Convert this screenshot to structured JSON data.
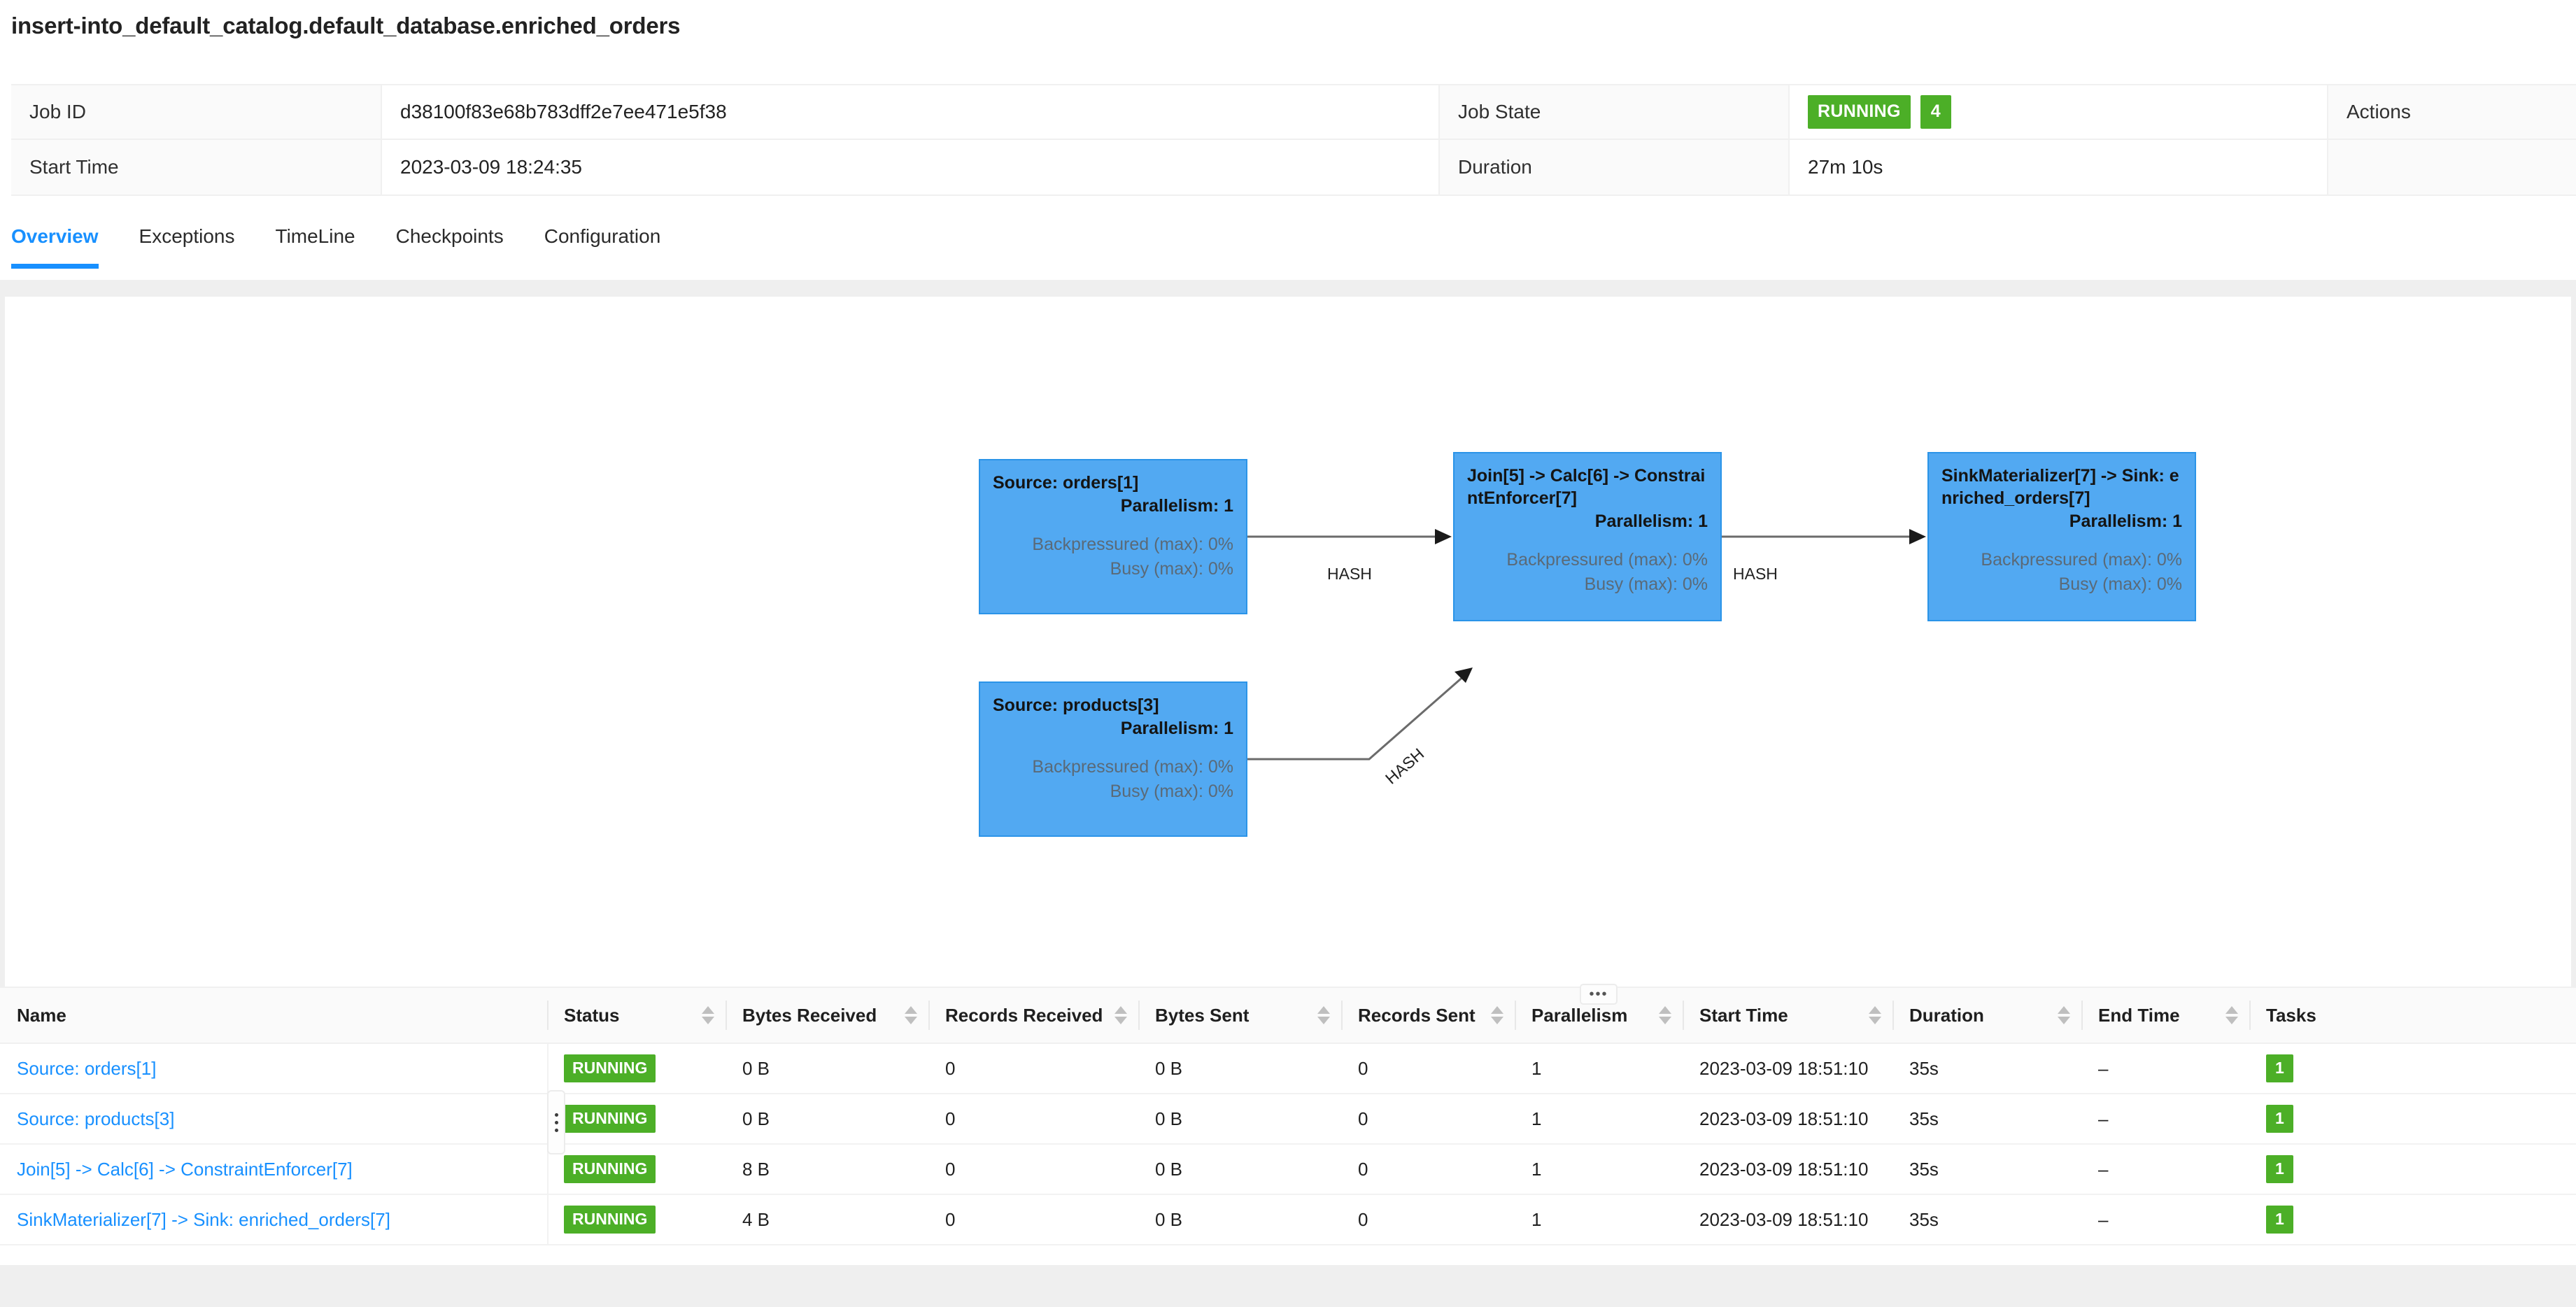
{
  "job": {
    "title": "insert-into_default_catalog.default_database.enriched_orders",
    "info_rows": [
      {
        "label": "Job ID",
        "value": "d38100f83e68b783dff2e7ee471e5f38",
        "label2": "Job State",
        "value2": "",
        "actions_label": "Actions"
      },
      {
        "label": "Start Time",
        "value": "2023-03-09 18:24:35",
        "label2": "Duration",
        "value2": "27m 10s"
      }
    ],
    "state_badge": "RUNNING",
    "state_count": "4",
    "actions_label": "Actions"
  },
  "tabs": [
    {
      "label": "Overview",
      "active": true
    },
    {
      "label": "Exceptions",
      "active": false
    },
    {
      "label": "TimeLine",
      "active": false
    },
    {
      "label": "Checkpoints",
      "active": false
    },
    {
      "label": "Configuration",
      "active": false
    }
  ],
  "graph": {
    "nodes": [
      {
        "id": "source-orders",
        "title": "Source: orders[1]",
        "parallelism": "Parallelism: 1",
        "backpressured": "Backpressured (max): 0%",
        "busy": "Busy (max): 0%"
      },
      {
        "id": "source-products",
        "title": "Source: products[3]",
        "parallelism": "Parallelism: 1",
        "backpressured": "Backpressured (max): 0%",
        "busy": "Busy (max): 0%"
      },
      {
        "id": "join-calc-constraint",
        "title": "Join[5] -> Calc[6] -> ConstraintEnforcer[7]",
        "parallelism": "Parallelism: 1",
        "backpressured": "Backpressured (max): 0%",
        "busy": "Busy (max): 0%"
      },
      {
        "id": "sink-materializer",
        "title": "SinkMaterializer[7] -> Sink: enriched_orders[7]",
        "parallelism": "Parallelism: 1",
        "backpressured": "Backpressured (max): 0%",
        "busy": "Busy (max): 0%"
      }
    ],
    "edges": [
      {
        "label": "HASH"
      },
      {
        "label": "HASH"
      },
      {
        "label": "HASH"
      }
    ],
    "drag_handle": "•••"
  },
  "table": {
    "columns": [
      "Name",
      "Status",
      "Bytes Received",
      "Records Received",
      "Bytes Sent",
      "Records Sent",
      "Parallelism",
      "Start Time",
      "Duration",
      "End Time",
      "Tasks"
    ],
    "rows": [
      {
        "name": "Source: orders[1]",
        "status": "RUNNING",
        "bytes_received": "0 B",
        "records_received": "0",
        "bytes_sent": "0 B",
        "records_sent": "0",
        "parallelism": "1",
        "start_time": "2023-03-09 18:51:10",
        "duration": "35s",
        "end_time": "–",
        "tasks": "1"
      },
      {
        "name": "Source: products[3]",
        "status": "RUNNING",
        "bytes_received": "0 B",
        "records_received": "0",
        "bytes_sent": "0 B",
        "records_sent": "0",
        "parallelism": "1",
        "start_time": "2023-03-09 18:51:10",
        "duration": "35s",
        "end_time": "–",
        "tasks": "1"
      },
      {
        "name": "Join[5] -> Calc[6] -> ConstraintEnforcer[7]",
        "status": "RUNNING",
        "bytes_received": "8 B",
        "records_received": "0",
        "bytes_sent": "0 B",
        "records_sent": "0",
        "parallelism": "1",
        "start_time": "2023-03-09 18:51:10",
        "duration": "35s",
        "end_time": "–",
        "tasks": "1"
      },
      {
        "name": "SinkMaterializer[7] -> Sink: enriched_orders[7]",
        "status": "RUNNING",
        "bytes_received": "4 B",
        "records_received": "0",
        "bytes_sent": "0 B",
        "records_sent": "0",
        "parallelism": "1",
        "start_time": "2023-03-09 18:51:10",
        "duration": "35s",
        "end_time": "–",
        "tasks": "1"
      }
    ]
  },
  "colors": {
    "accent_blue": "#1890ff",
    "node_blue": "#52a9f2",
    "node_border": "#2b94e8",
    "status_green": "#4caf27",
    "panel_gray": "#efefef"
  }
}
